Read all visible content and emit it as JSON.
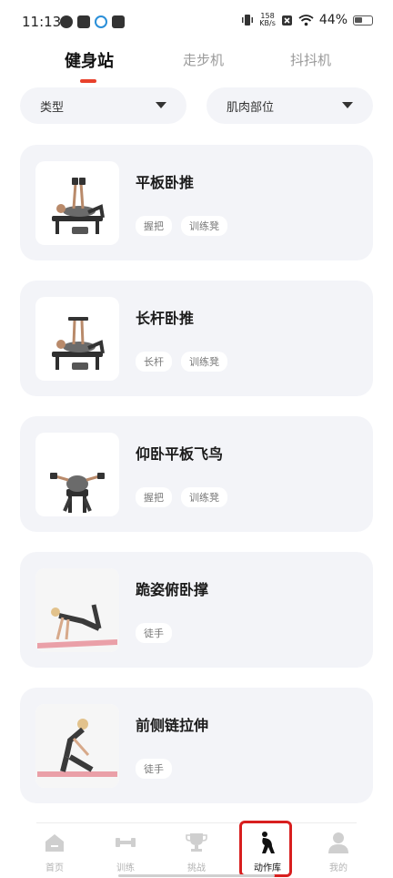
{
  "status_bar": {
    "time": "11:13",
    "netspeed_value": "158",
    "netspeed_unit": "KB/s",
    "battery": "44%"
  },
  "tabs": [
    {
      "label": "健身站",
      "active": true
    },
    {
      "label": "走步机",
      "active": false
    },
    {
      "label": "抖抖机",
      "active": false
    }
  ],
  "filters": {
    "type_label": "类型",
    "muscle_label": "肌肉部位"
  },
  "exercises": [
    {
      "title": "平板卧推",
      "tags": [
        "握把",
        "训练凳"
      ]
    },
    {
      "title": "长杆卧推",
      "tags": [
        "长杆",
        "训练凳"
      ]
    },
    {
      "title": "仰卧平板飞鸟",
      "tags": [
        "握把",
        "训练凳"
      ]
    },
    {
      "title": "跪姿俯卧撑",
      "tags": [
        "徒手"
      ]
    },
    {
      "title": "前侧链拉伸",
      "tags": [
        "徒手"
      ]
    }
  ],
  "bottom_nav": [
    {
      "label": "首页",
      "icon": "home-icon"
    },
    {
      "label": "训练",
      "icon": "dumbbell-icon"
    },
    {
      "label": "挑战",
      "icon": "trophy-icon"
    },
    {
      "label": "动作库",
      "icon": "stretch-figure-icon",
      "active": true
    },
    {
      "label": "我的",
      "icon": "user-icon"
    }
  ],
  "colors": {
    "accent": "#e8412c",
    "card_bg": "#f3f4f8",
    "highlight": "#d81f1f"
  }
}
